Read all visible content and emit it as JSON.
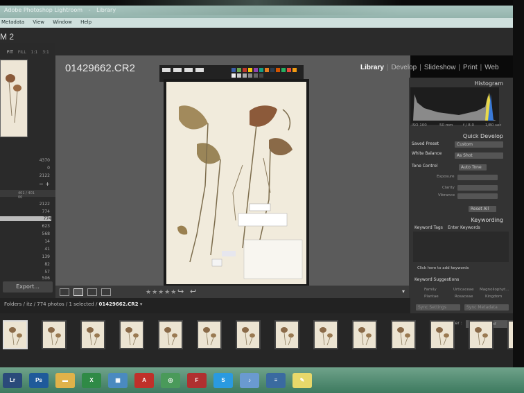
{
  "window": {
    "title_parts": [
      "Adobe Photoshop Lightroom",
      "-",
      "Library"
    ]
  },
  "menubar": {
    "items": [
      "Metadata",
      "View",
      "Window",
      "Help"
    ]
  },
  "app": {
    "logo_text": "M 2"
  },
  "navigator": {
    "tabs": [
      "FIT",
      "FILL",
      "1:1",
      "3:1"
    ]
  },
  "left_panel": {
    "counts_top": [
      "4370",
      "0",
      "2122"
    ],
    "collection_header": "401 / 401 00",
    "counts_list": [
      "2122",
      "774",
      "774",
      "623",
      "568",
      "14",
      "41",
      "139",
      "82",
      "57",
      "506"
    ],
    "highlighted_index": 2,
    "export_label": "Export..."
  },
  "loupe": {
    "filename": "01429662.CR2"
  },
  "modules": {
    "items": [
      "Library",
      "Develop",
      "Slideshow",
      "Print",
      "Web"
    ],
    "active": "Library"
  },
  "toolbar": {
    "stars": "★★★★★"
  },
  "pathbar": {
    "prefix": "Folders / itz / 774 photos / 1 selected /",
    "file": "01429662.CR2",
    "dropdown": "▾"
  },
  "right_panel": {
    "histogram": {
      "title": "Histogram",
      "readouts": [
        "ISO 100",
        "50 mm",
        "f / 8.0",
        "1/80 sec"
      ]
    },
    "quick_develop": {
      "title": "Quick Develop",
      "saved_preset_label": "Saved Preset",
      "saved_preset_value": "Custom",
      "white_balance_label": "White Balance",
      "white_balance_value": "As Shot",
      "tone_control_label": "Tone Control",
      "tone_control_value": "Auto Tone",
      "exposure_label": "Exposure",
      "clarity_label": "Clarity",
      "vibrance_label": "Vibrance",
      "reset_label": "Reset All"
    },
    "keywording": {
      "title": "Keywording",
      "tags_label": "Keyword Tags",
      "tags_value": "Enter Keywords",
      "add_hint": "Click here to add keywords",
      "suggestions_label": "Keyword Suggestions",
      "suggestions": [
        "Family",
        "Urticaceae",
        "Magnoliophyt...",
        "Plantae",
        "Rosaceae",
        "Kingdom"
      ]
    },
    "buttons": [
      "Sync Settings",
      "Sync Metadata"
    ]
  },
  "filmstrip": {
    "filter_label": "Filter :",
    "filter_value": "Custom Filter",
    "thumb_count": 14
  },
  "colors": {
    "panel": "#2b2b2b",
    "center": "#5b5b5b",
    "active_text": "#ffffff",
    "taskbar": "#4c8a6d",
    "highlight_row": "#bbbbbb"
  },
  "taskbar": {
    "icons": [
      "Lr",
      "Ps",
      "folder-icon",
      "excel-icon",
      "calendar-icon",
      "acrobat-icon",
      "chrome-icon",
      "filezilla-icon",
      "skype-icon",
      "itunes-icon",
      "network-icon",
      "notes-icon"
    ]
  }
}
